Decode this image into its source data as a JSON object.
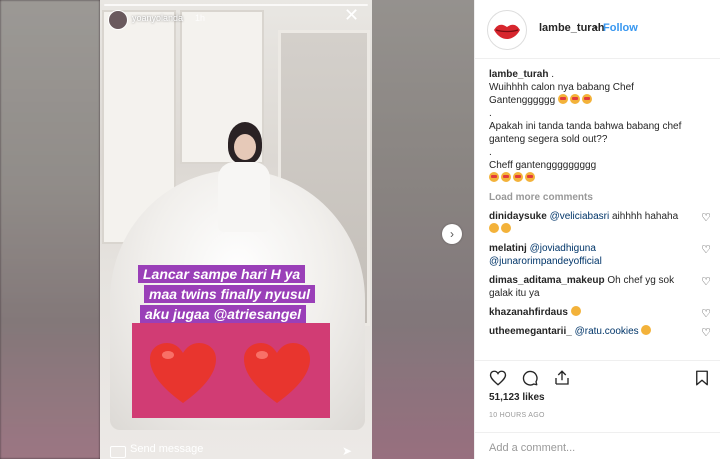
{
  "story": {
    "username": "yoanyolanda",
    "time": "1h",
    "close_glyph": "✕",
    "caption_lines": [
      "Lancar sampe hari H ya",
      "maa twins  finally nyusul",
      "aku jugaa @atriesangel"
    ],
    "send_message_placeholder": "Send message",
    "hearts_color": "#e8352e",
    "box_color": "#d13c74",
    "caption_color": "#9a3fb8"
  },
  "nav": {
    "next_glyph": "›"
  },
  "post": {
    "username": "lambe_turah",
    "dot": "•",
    "follow_label": "Follow",
    "accent": "#3897f0",
    "caption": {
      "user": "lambe_turah",
      "lines": [
        "Wuihhhh calon nya babang Chef",
        "Ganteng",
        ".",
        "Apakah ini tanda tanda bahwa babang chef ganteng segera sold out??",
        ".",
        "Cheff ganteng"
      ],
      "line1_suffix": " .",
      "ganteng_suffix": "ggggg",
      "cheff_suffix": "gggggggg"
    },
    "load_more": "Load more comments",
    "comments": [
      {
        "user": "dinidaysuke",
        "mention": "@veliciabasri",
        "text": " aihhhh hahaha"
      },
      {
        "user": "melatinj",
        "mention": "@joviadhiguna",
        "mention2": "@junarorimpandeyofficial",
        "text": ""
      },
      {
        "user": "dimas_aditama_makeup",
        "mention": "",
        "text": "Oh chef yg sok galak itu ya"
      },
      {
        "user": "khazanahfirdaus",
        "mention": "",
        "text": ""
      },
      {
        "user": "utheemegantarii_",
        "mention": "@ratu.cookies",
        "text": ""
      }
    ],
    "likes": "51,123 likes",
    "time_ago": "10 HOURS AGO",
    "add_comment_placeholder": "Add a comment..."
  },
  "icons": [
    "close-icon",
    "heart-icon",
    "comment-icon",
    "share-icon",
    "bookmark-icon",
    "camera-icon",
    "send-icon",
    "chevron-right-icon"
  ]
}
